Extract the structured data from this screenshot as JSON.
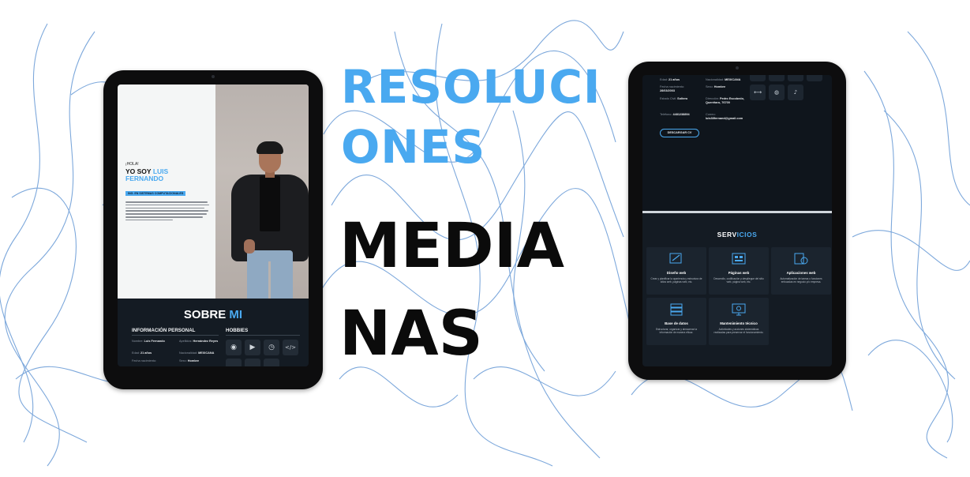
{
  "headline": {
    "blue_line1": "RESOLUCI",
    "blue_line2": "ONES",
    "black_line1": "MEDIA",
    "black_line2": "NAS"
  },
  "colors": {
    "accent": "#4aa9f0",
    "lines": "#6f9fd8",
    "dark_bg": "#141b23"
  },
  "left_screen": {
    "greeting": "¡HOLA!",
    "intro": "YO SOY",
    "name_first": "LUIS",
    "name_last": "FERNANDO",
    "degree": "ING. EN SISTEMAS COMPUTACIONALES",
    "about_title": "SOBRE",
    "about_title_accent": "MI",
    "personal_heading": "INFORMACIÓN PERSONAL",
    "hobbies_heading": "HOBBIES",
    "fields": [
      {
        "label": "Nombre:",
        "value": "Luis Fernando"
      },
      {
        "label": "Apellidos:",
        "value": "Hernández Reyes"
      },
      {
        "label": "Edad:",
        "value": "21 años"
      },
      {
        "label": "Nacionalidad:",
        "value": "MEXICANA"
      },
      {
        "label": "Fecha nacimiento:",
        "value": ""
      },
      {
        "label": "Sexo:",
        "value": "Hombre"
      }
    ],
    "hobby_icons": [
      "spotify-icon",
      "youtube-icon",
      "clock-icon",
      "code-icon"
    ]
  },
  "right_screen": {
    "fields": [
      {
        "label": "Edad:",
        "value": "21 años"
      },
      {
        "label": "Nacionalidad:",
        "value": "MEXICANA"
      },
      {
        "label": "Fecha nacimiento:",
        "value": "28/03/2003"
      },
      {
        "label": "Sexo:",
        "value": "Hombre"
      },
      {
        "label": "Estado Civil:",
        "value": "Soltero"
      },
      {
        "label": "Dirección:",
        "value": "Pedro Escobedo, Querétaro, 76700"
      },
      {
        "label": "Teléfono:",
        "value": "4481238894"
      },
      {
        "label": "Correo:",
        "value": "luis38fernand@gmail.com"
      }
    ],
    "cv_button": "DESCARGAR CV",
    "services_title": "SERV",
    "services_title_accent": "ICIOS",
    "services": [
      {
        "title": "Diseño web",
        "desc": "Crear y planificar la apariencia y estructura de sitios web, páginas web, etc.",
        "icon": "design-icon"
      },
      {
        "title": "Páginas web",
        "desc": "Desarrollo, codificación y despliegue del sitio web, página web, etc.",
        "icon": "webpage-icon"
      },
      {
        "title": "Aplicaciones web",
        "desc": "Automatización de tareas o funciones enfocadas en negocio y/o empresa.",
        "icon": "app-icon"
      },
      {
        "title": "Base de datos",
        "desc": "Estructurar, organizar y almacenar la información de manera eficaz.",
        "icon": "database-icon"
      },
      {
        "title": "Mantenimiento técnico",
        "desc": "Actividades y acciones sistemáticas realizadas para preservar el funcionamiento.",
        "icon": "maintenance-icon"
      }
    ]
  }
}
